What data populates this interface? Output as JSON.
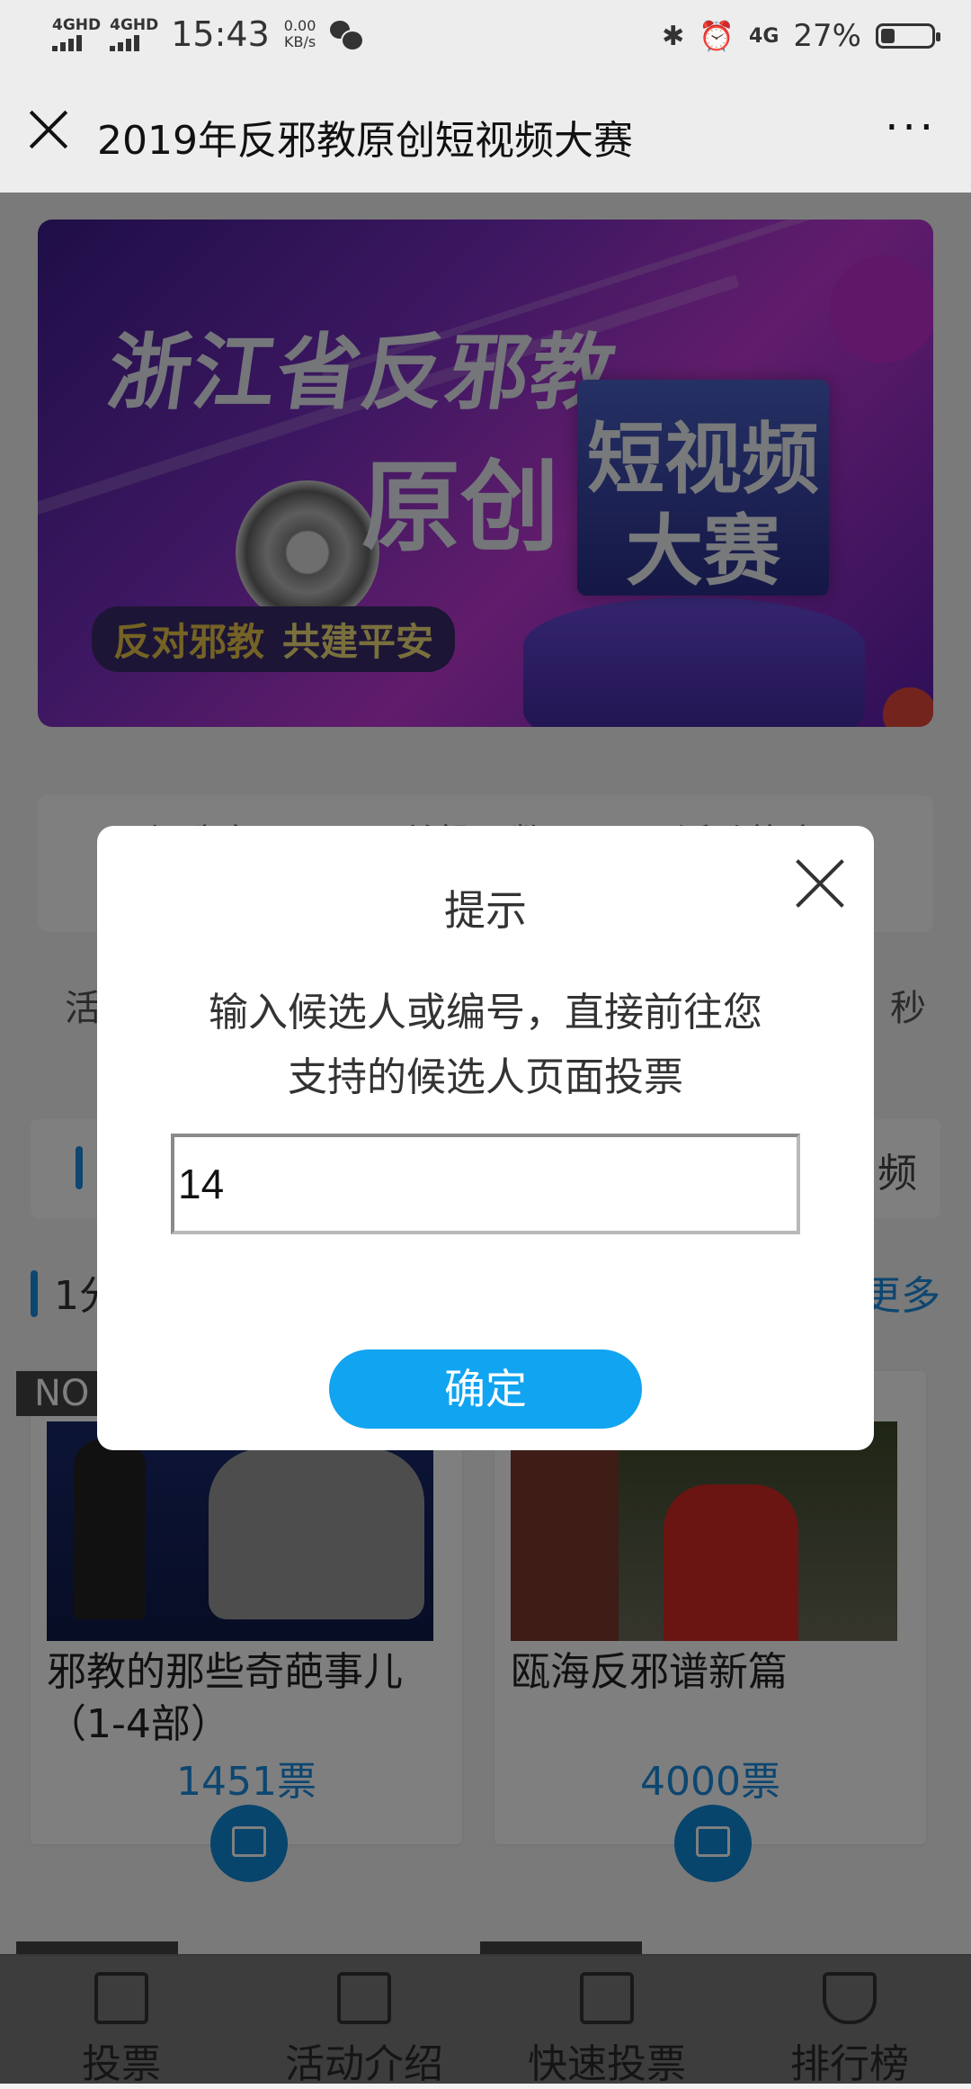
{
  "status_bar": {
    "signal1": "4GHD",
    "signal2": "4GHD",
    "time": "15:43",
    "speed_value": "0.00",
    "speed_unit": "KB/s",
    "network": "4G",
    "battery": "27%",
    "battery_level": 0.27
  },
  "header": {
    "title": "2019年反邪教原创短视频大赛",
    "more": "···"
  },
  "banner": {
    "line1": "浙江省反邪教",
    "line2": "原创",
    "box_line1": "短视频",
    "box_line2": "大赛",
    "slogan1": "反对邪教",
    "slogan2": "共建平安"
  },
  "stats": {
    "col1": "候选人",
    "col2": "总投票数",
    "col3": "活动热度"
  },
  "activity": {
    "left": "活",
    "right": "秒"
  },
  "search_row": {
    "right_text": "频"
  },
  "section": {
    "title": "1分",
    "more": "更多"
  },
  "cards": [
    {
      "no": "NO",
      "title": "邪教的那些奇葩事儿（1-4部）",
      "votes": "1451票"
    },
    {
      "no": "",
      "title": "瓯海反邪谱新篇",
      "votes": "4000票"
    }
  ],
  "tabs": [
    {
      "label": "投票"
    },
    {
      "label": "活动介绍"
    },
    {
      "label": "快速投票"
    },
    {
      "label": "排行榜"
    }
  ],
  "dialog": {
    "title": "提示",
    "message_line1": "输入候选人或编号，直接前往您",
    "message_line2": "支持的候选人页面投票",
    "input_value": "14",
    "confirm": "确定"
  }
}
